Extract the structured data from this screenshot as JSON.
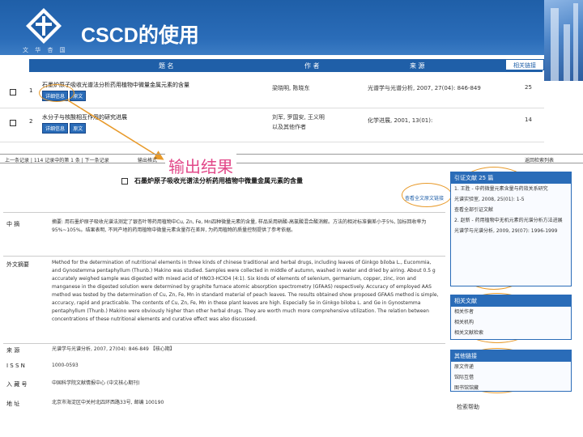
{
  "slide": {
    "title": "CSCD的使用",
    "logo_text": "文 华 杏 国"
  },
  "table": {
    "headers": [
      "题  名",
      "作  者",
      "来  源"
    ],
    "tab_label": "相关链接",
    "rows": [
      {
        "num": "1",
        "title": "石墨炉原子吸收光谱法分析药用植物中微量金属元素的含量",
        "btn1": "详细信息",
        "btn2": "原文",
        "authors": "梁晓明, 陈晓东",
        "source": "光谱学与光谱分析, 2007, 27(04): 846-849",
        "extra": "25"
      },
      {
        "num": "2",
        "title": "水分子与核酸相互作用的研究进展",
        "btn1": "详细信息",
        "btn2": "原文",
        "authors": "刘军, 罗国安, 王义明",
        "authors2": "以及其他作者",
        "source": "化学进展, 2001, 13(01):",
        "extra": "14"
      }
    ]
  },
  "navbar": {
    "left": "上一条记录 | 114 记录中的第 1 条 | 下一条记录",
    "mid": "输出格式",
    "right": "返回检索列表"
  },
  "callout": "输出结果",
  "detail": {
    "title": "石墨炉原子吸收光谱法分析药用植物中微量金属元素的含量",
    "fulltext_btn": "查看全文原文链接",
    "abstract_label": "中  摘",
    "abstract_cn": "摘要: 用石墨炉原子吸收光谱法测定了银杏叶等药用植物中Cu, Zn, Fe, Mn四种微量元素的含量, 样品采用硝酸-高氯酸混合酸消解。方法的相对标准偏差小于5%, 加标回收率为95%~105%。结果表明, 不同产地的药用植物中微量元素含量存在差异, 为药用植物的质量控制提供了参考依据。",
    "en_label": "外文摘要",
    "abstract_en": "Method for the determination of nutritional elements in three kinds of chinese traditional and herbal drugs, including leaves of Ginkgo biloba L., Eucommia, and Gynostemma pentaphyllum (Thunb.) Makino was studied. Samples were collected in middle of autumn, washed in water and dried by airing. About 0.5 g accurately weighed sample was digested with mixed acid of HNO3-HClO4 (4:1). Six kinds of elements of selenium, germanium, copper, zinc, iron and manganese in the digested solution were determined by graphite furnace atomic absorption spectrometry (GFAAS) respectively. Accuracy of employed AAS method was tested by the determination of Cu, Zn, Fe, Mn in standard material of peach leaves. The results obtained show proposed GFAAS method is simple, accuracy, rapid and practicable. The contents of Cu, Zn, Fe, Mn in these plant leaves are high. Especially Se in Ginkgo biloba L. and Ge in Gynostemma pentaphyllum (Thunb.) Makino were obviously higher than other herbal drugs. They are worth much more comprehensive utilization. The relation between concentrations of these nutritional elements and curative effect was also discussed.",
    "journal_label": "来  源",
    "journal": "光谱学与光谱分析, 2007, 27(04): 846-849 【核心期】",
    "issn_label": "I S S N",
    "issn": "1000-0593",
    "inst_label": "入 藏 号",
    "inst": "中国科学院文献情报中心 (中文核心期刊)",
    "addr_label": "地  址",
    "addr": "北京市海淀区中关村北四环西路33号, 邮编 100190"
  },
  "sidebar": {
    "cited_header": "引证文献  25 篇",
    "cited_1": "1.  王胜 - 中药微量元素含量与药效关系研究",
    "cited_1_src": "光谱实验室, 2008, 25(01): 1-5",
    "cited_more": "查看全部引证文献",
    "cited_2": "2.  赵新 - 药用植物中无机元素的光谱分析方法进展",
    "cited_2_src": "光谱学与光谱分析, 2009, 29(07): 1996-1999",
    "related_header": "相关文献",
    "related": [
      "相关作者",
      "相关机构",
      "相关文献检索"
    ],
    "links_header": "其他链接",
    "links": [
      "原文传递",
      "馆际互借",
      "图书馆馆藏"
    ],
    "footer": "检索帮助"
  }
}
